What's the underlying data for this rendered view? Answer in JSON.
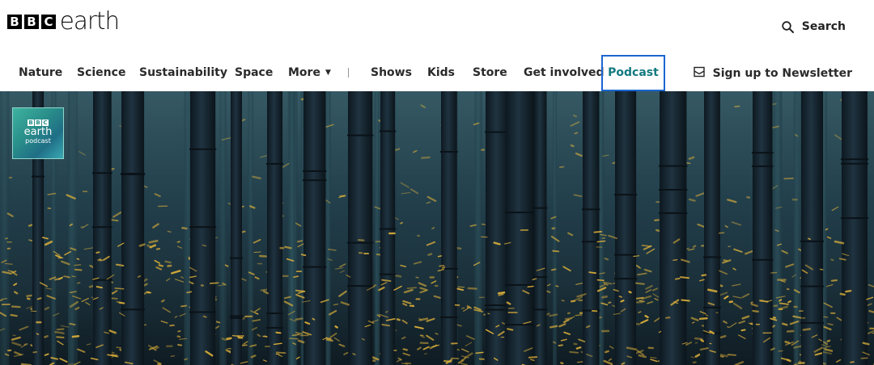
{
  "brand": {
    "bbc_letters": [
      "B",
      "B",
      "C"
    ],
    "wordmark": "earth"
  },
  "search": {
    "label": "Search",
    "icon": "search-icon"
  },
  "nav": {
    "items": [
      {
        "label": "Nature"
      },
      {
        "label": "Science"
      },
      {
        "label": "Sustainability"
      },
      {
        "label": "Space"
      },
      {
        "label": "More"
      },
      {
        "label": "Shows"
      },
      {
        "label": "Kids"
      },
      {
        "label": "Store"
      },
      {
        "label": "Get involved"
      },
      {
        "label": "Podcast",
        "active": true
      }
    ],
    "newsletter_label": "Sign up to Newsletter",
    "newsletter_icon": "mail-icon"
  },
  "hero": {
    "badge": {
      "bbc_letters": [
        "B",
        "B",
        "C"
      ],
      "earth": "earth",
      "podcast": "podcast"
    },
    "image_description_icon": "bamboo-forest-fireflies-image"
  },
  "colors": {
    "active_nav_text": "#127a80",
    "active_nav_border": "#1b66d0",
    "firefly": "#e0b23a",
    "forest_dark": "#14222b"
  }
}
